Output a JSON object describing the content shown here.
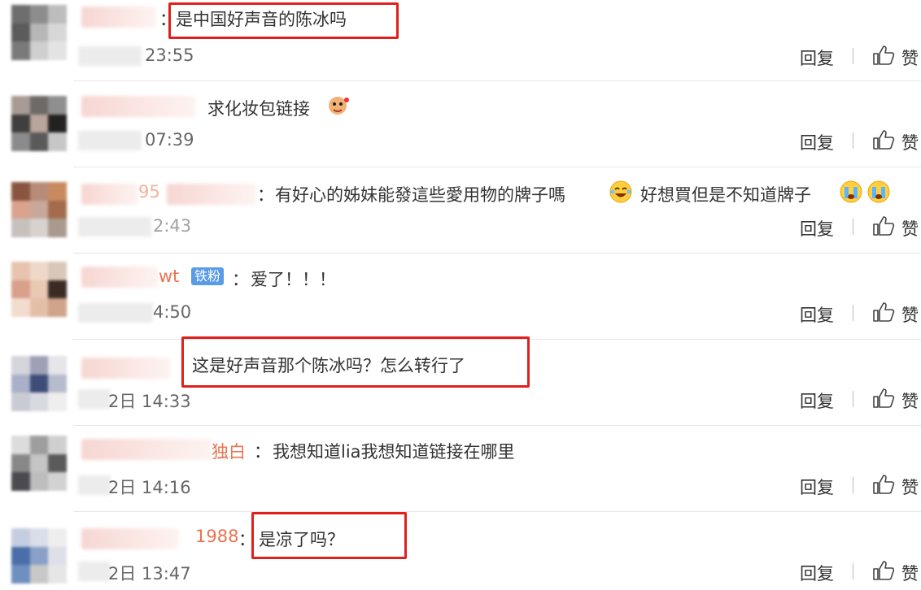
{
  "actions": {
    "reply": "回复",
    "like": "赞"
  },
  "comments": [
    {
      "name_tail": "",
      "text": "是中国好声音的陈冰吗",
      "time": "23:55"
    },
    {
      "name_tail": "",
      "text": "求化妆包链接",
      "time": "07:39"
    },
    {
      "name_tail": "95",
      "text": "有好心的姊妹能發這些愛用物的牌子嗎",
      "text2": "好想買但是不知道牌子",
      "time": "2:43"
    },
    {
      "name_tail": "wt",
      "badge": "铁粉",
      "text": "爱了！！！",
      "time": "4:50"
    },
    {
      "name_tail": "",
      "text": "这是好声音那个陈冰吗？怎么转行了",
      "time": "2日 14:33"
    },
    {
      "name_tail": "独白",
      "text": "我想知道lia我想知道链接在哪里",
      "time": "2日 14:16"
    },
    {
      "name_tail": "1988",
      "text": "是凉了吗？",
      "time": "2日 13:47"
    }
  ],
  "icons": {
    "like": "thumbs-up-icon",
    "emoji": [
      "gift-emoji-icon",
      "laugh-cry-emoji-icon",
      "cry-emoji-icon"
    ]
  },
  "colors": {
    "highlight": "#e0201b",
    "name": "#eb7350",
    "badge": "#5a9be6"
  }
}
